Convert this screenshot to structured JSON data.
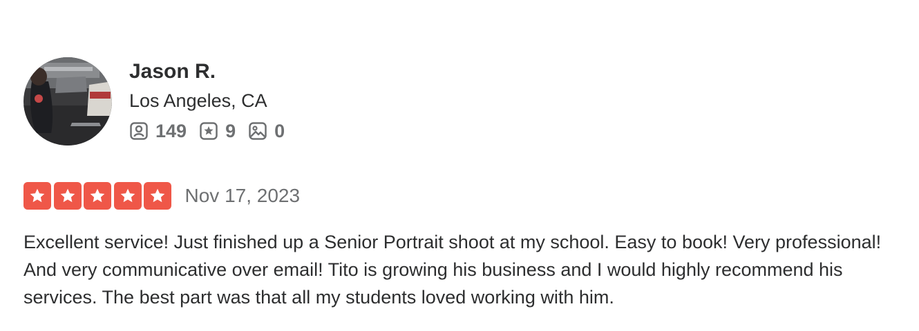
{
  "user": {
    "name": "Jason R.",
    "location": "Los Angeles, CA",
    "stats": {
      "friends": "149",
      "reviews": "9",
      "photos": "0"
    },
    "icons": {
      "friends": "friends-icon",
      "reviews": "reviews-icon",
      "photos": "photos-icon"
    }
  },
  "review": {
    "rating": 5,
    "rating_max": 5,
    "date": "Nov 17, 2023",
    "text": "Excellent service! Just finished up a Senior Portrait shoot at my school. Easy to book! Very professional! And very communicative over email! Tito is growing his business and I would highly recommend his services. The best part was that all my students loved working with him."
  },
  "colors": {
    "star_fill": "#ef5748",
    "text_primary": "#2d2e2f",
    "text_secondary": "#6e7072"
  }
}
